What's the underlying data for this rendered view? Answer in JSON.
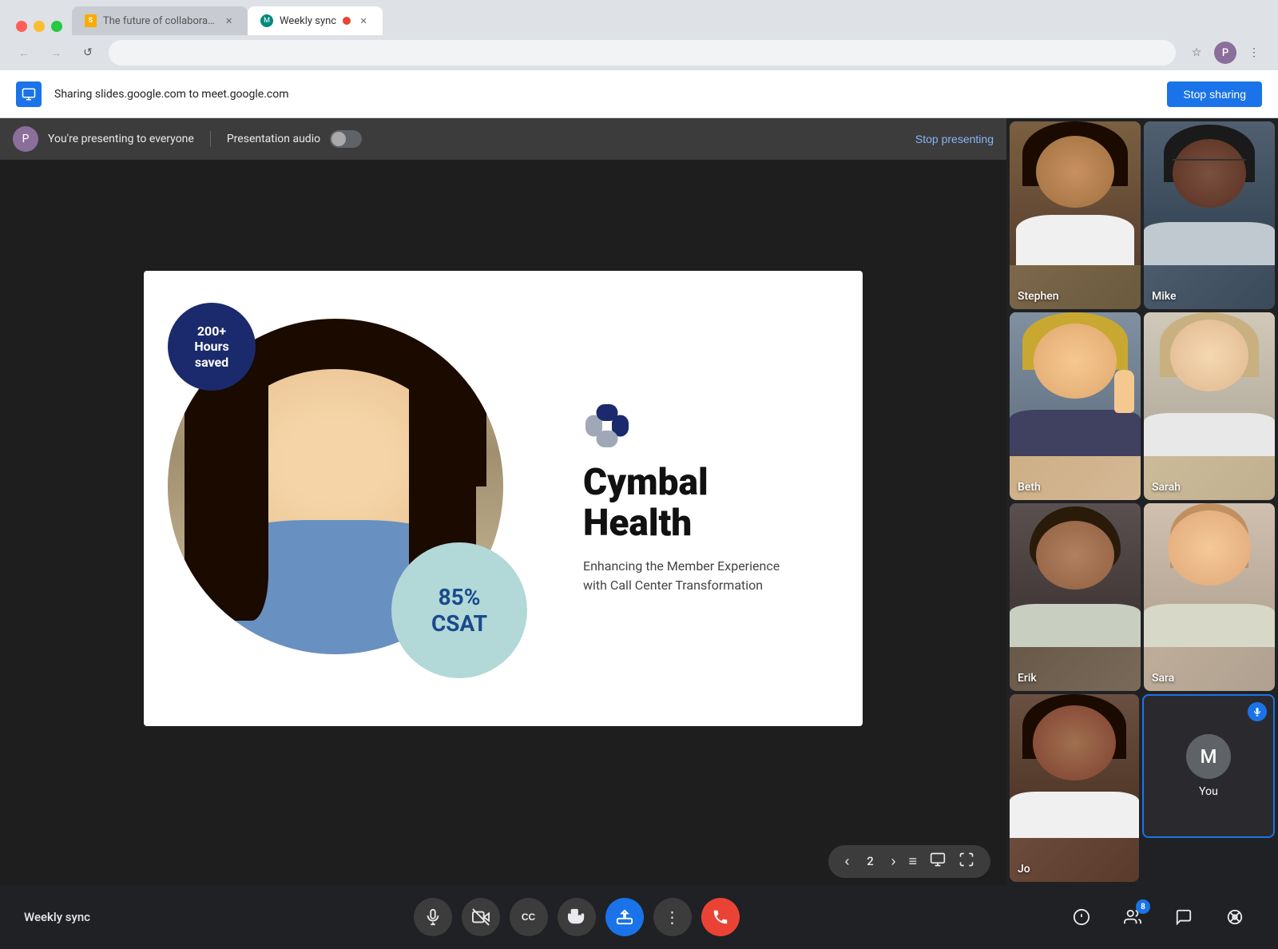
{
  "browser": {
    "tabs": [
      {
        "id": "slides-tab",
        "label": "The future of collaboration",
        "favicon_type": "slides",
        "active": false,
        "recording": false
      },
      {
        "id": "meet-tab",
        "label": "Weekly sync",
        "favicon_type": "meet",
        "active": true,
        "recording": true
      }
    ],
    "address_bar_url": "",
    "profile_initial": "P"
  },
  "share_bar": {
    "icon_label": "share",
    "message": "Sharing slides.google.com to meet.google.com",
    "stop_sharing_label": "Stop sharing"
  },
  "presenter_bar": {
    "presenter_text": "You're presenting to everyone",
    "audio_label": "Presentation audio",
    "stop_presenting_label": "Stop presenting"
  },
  "slide": {
    "dark_circle_text": "200+\nHours\nsaved",
    "teal_circle_text": "85%\nCSAT",
    "brand_name_line1": "Cymbal",
    "brand_name_line2": "Health",
    "subtitle": "Enhancing the Member Experience\nwith Call Center Transformation"
  },
  "slide_controls": {
    "prev_label": "‹",
    "page_number": "2",
    "next_label": "›",
    "list_label": "≡",
    "camera_label": "⊡",
    "fullscreen_label": "⤢"
  },
  "participants": [
    {
      "id": "stephen",
      "name": "Stephen",
      "row": 0,
      "col": 0,
      "tile_class": "tile-stephen",
      "hair_color": "#1a1a1a",
      "skin_color": "#8b6040",
      "shirt_color": "#f0f0f0"
    },
    {
      "id": "mike",
      "name": "Mike",
      "row": 0,
      "col": 1,
      "tile_class": "tile-mike",
      "hair_color": "#1a1a1a",
      "skin_color": "#6b4030",
      "shirt_color": "#c8d8e8"
    },
    {
      "id": "beth",
      "name": "Beth",
      "row": 1,
      "col": 0,
      "tile_class": "tile-beth",
      "hair_color": "#c8a030",
      "skin_color": "#f0c898",
      "shirt_color": "#404060"
    },
    {
      "id": "sarah",
      "name": "Sarah",
      "row": 1,
      "col": 1,
      "tile_class": "tile-sarah",
      "hair_color": "#c8b080",
      "skin_color": "#f5d8b0",
      "shirt_color": "#f8f8f8"
    },
    {
      "id": "erik",
      "name": "Erik",
      "row": 2,
      "col": 0,
      "tile_class": "tile-erik",
      "hair_color": "#2a1a0a",
      "skin_color": "#b08060",
      "shirt_color": "#d0d8c0"
    },
    {
      "id": "sara",
      "name": "Sara",
      "row": 2,
      "col": 1,
      "tile_class": "tile-sara",
      "hair_color": "#c09060",
      "skin_color": "#f0c898",
      "shirt_color": "#e8e8d8"
    },
    {
      "id": "jo",
      "name": "Jo",
      "row": 3,
      "col": 0,
      "tile_class": "tile-jo",
      "hair_color": "#1a0a00",
      "skin_color": "#7a5040",
      "shirt_color": "#f0f0f0"
    },
    {
      "id": "you",
      "name": "You",
      "row": 3,
      "col": 1,
      "tile_class": "tile-you",
      "initial": "M",
      "speaking": true
    }
  ],
  "bottom_bar": {
    "meeting_name": "Weekly sync",
    "controls": [
      {
        "id": "mic",
        "icon": "🎙",
        "type": "normal"
      },
      {
        "id": "camera",
        "icon": "📷",
        "type": "normal"
      },
      {
        "id": "captions",
        "icon": "CC",
        "type": "normal"
      },
      {
        "id": "raise-hand",
        "icon": "✋",
        "type": "normal"
      },
      {
        "id": "present",
        "icon": "⬆",
        "type": "blue"
      },
      {
        "id": "more",
        "icon": "⋮",
        "type": "normal"
      },
      {
        "id": "leave",
        "icon": "📞",
        "type": "red"
      }
    ],
    "right_controls": [
      {
        "id": "info",
        "icon": "ℹ",
        "badge": null
      },
      {
        "id": "people",
        "icon": "👥",
        "badge": "8"
      },
      {
        "id": "chat",
        "icon": "💬",
        "badge": null
      },
      {
        "id": "activities",
        "icon": "⚙",
        "badge": null
      }
    ]
  }
}
